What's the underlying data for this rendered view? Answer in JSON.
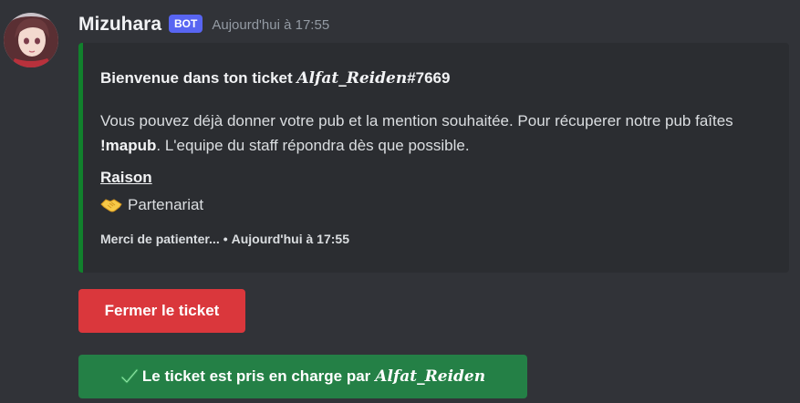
{
  "message": {
    "author": "Mizuhara",
    "badge": "BOT",
    "timestamp": "Aujourd'hui à 17:55",
    "avatar_icon": "anime-avatar-icon"
  },
  "embed": {
    "accent_color": "#11812c",
    "title_prefix": "Bienvenue dans ton ticket ",
    "title_name": "𝑨𝒍𝒇𝒂𝒕_𝑹𝒆𝒊𝒅𝒆𝒏",
    "title_suffix": "#7669",
    "description_part1": "Vous pouvez déjà donner votre pub et la mention souhaitée. Pour récuperer notre pub faîtes ",
    "description_command": "!mapub",
    "description_part2": ". L'equipe du staff répondra dès que possible.",
    "field_name": "Raison",
    "field_value": "Partenariat",
    "field_icon": "handshake-icon",
    "footer_text": "Merci de patienter...",
    "footer_separator": "•",
    "footer_timestamp": "Aujourd'hui à 17:55"
  },
  "buttons": {
    "close_label": "Fermer le ticket",
    "close_color": "#da373c",
    "claimed_label": "Le ticket est pris en charge par",
    "claimed_name": "𝑨𝒍𝒇𝒂𝒕_𝑹𝒆𝒊𝒅𝒆𝒏",
    "claimed_color": "#248046",
    "claimed_icon": "checkmark-icon"
  }
}
